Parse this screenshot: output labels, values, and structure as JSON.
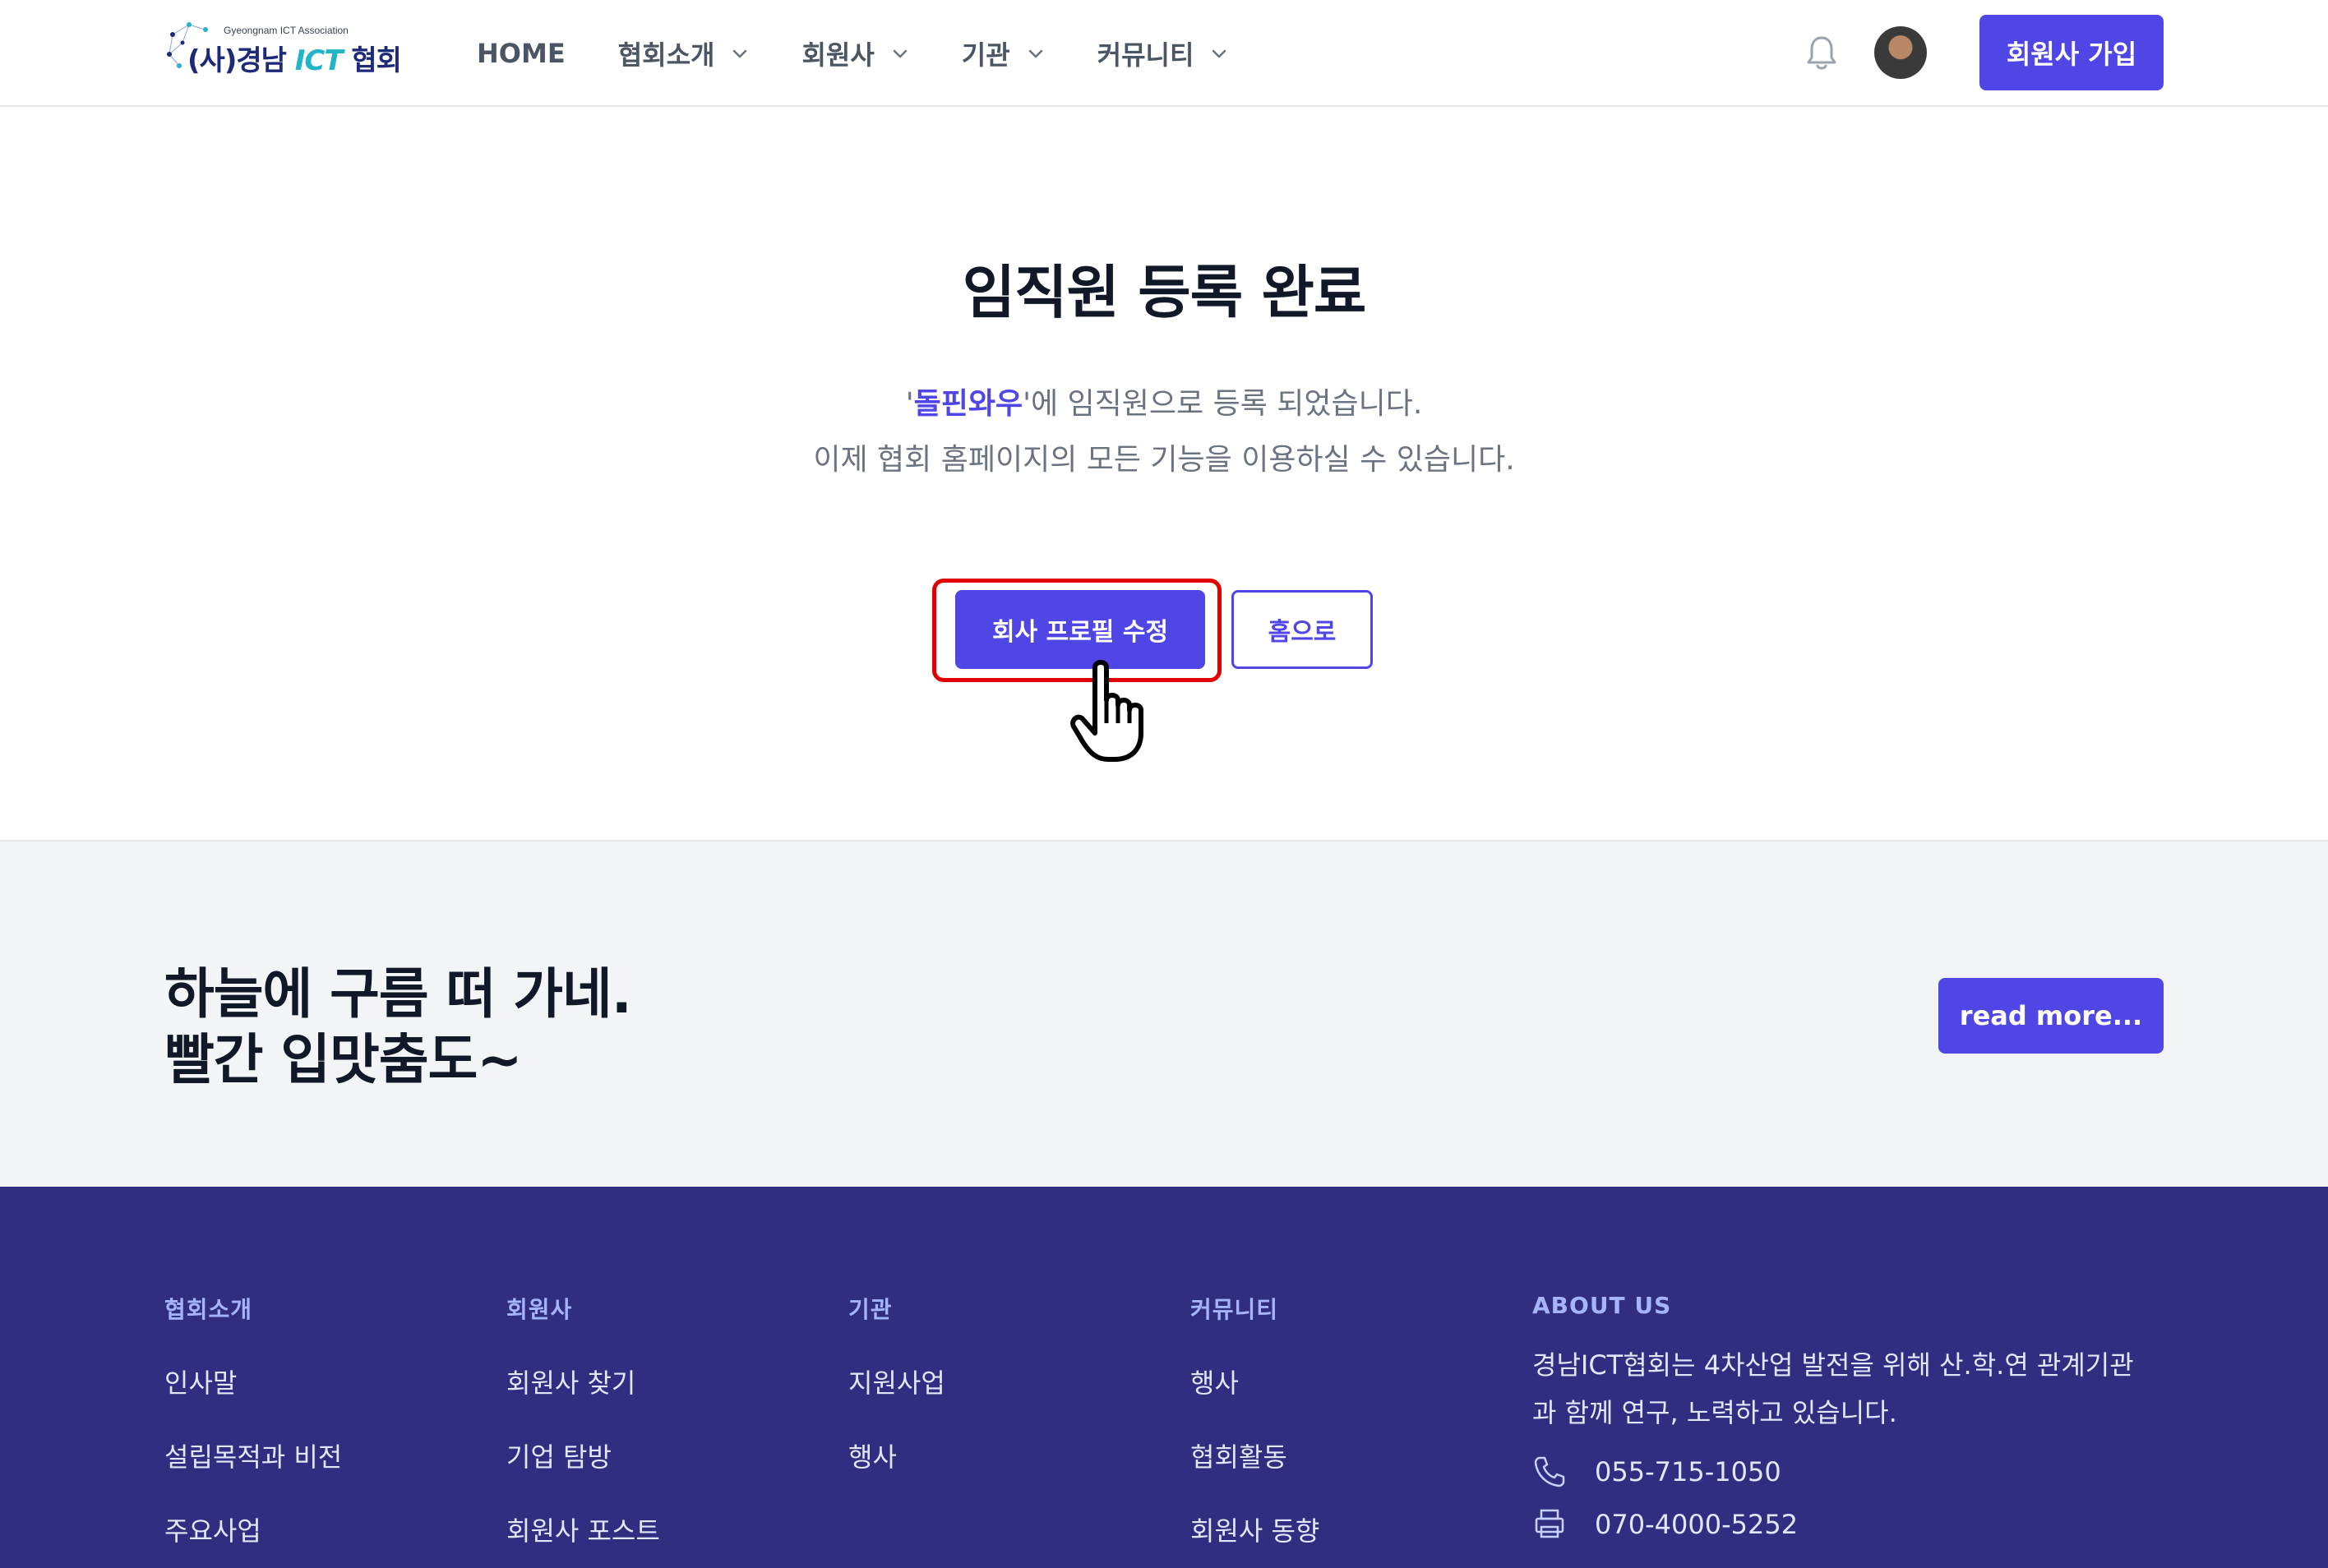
{
  "header": {
    "logo_en": "Gyeongnam ICT Association",
    "logo_prefix": "(사)경남 ",
    "logo_ict": "ICT",
    "logo_suffix": " 협회",
    "nav": [
      {
        "label": "HOME",
        "dropdown": false
      },
      {
        "label": "협회소개",
        "dropdown": true
      },
      {
        "label": "회원사",
        "dropdown": true
      },
      {
        "label": "기관",
        "dropdown": true
      },
      {
        "label": "커뮤니티",
        "dropdown": true
      }
    ],
    "join_label": "회원사 가입"
  },
  "hero": {
    "title": "임직원 등록 완료",
    "quote_open": "'",
    "company": "돌핀와우",
    "message1_suffix": "'에 임직원으로 등록 되었습니다.",
    "message2": "이제 협회 홈페이지의 모든 기능을 이용하실 수 있습니다.",
    "edit_profile_label": "회사 프로필 수정",
    "home_label": "홈으로"
  },
  "cta": {
    "line1": "하늘에 구름 떠 가네.",
    "line2": "빨간 입맛춤도~",
    "read_more_label": "read more..."
  },
  "footer": {
    "columns": [
      {
        "heading": "협회소개",
        "links": [
          "인사말",
          "설립목적과 비전",
          "주요사업"
        ]
      },
      {
        "heading": "회원사",
        "links": [
          "회원사 찾기",
          "기업 탐방",
          "회원사 포스트"
        ]
      },
      {
        "heading": "기관",
        "links": [
          "지원사업",
          "행사"
        ]
      },
      {
        "heading": "커뮤니티",
        "links": [
          "행사",
          "협회활동",
          "회원사 동향"
        ]
      }
    ],
    "about": {
      "heading": "ABOUT US",
      "text": "경남ICT협회는 4차산업 발전을 위해 산.학.연 관계기관과 함께 연구, 노력하고 있습니다.",
      "phone": "055-715-1050",
      "fax": "070-4000-5252"
    }
  },
  "colors": {
    "accent": "#4f46e5",
    "footer_bg": "#312e81",
    "cta_bg": "#f3f4f6",
    "highlight": "#e00000"
  },
  "icons": [
    "bell-icon",
    "chevron-down-icon",
    "hand-pointer-icon",
    "phone-icon",
    "fax-icon"
  ]
}
